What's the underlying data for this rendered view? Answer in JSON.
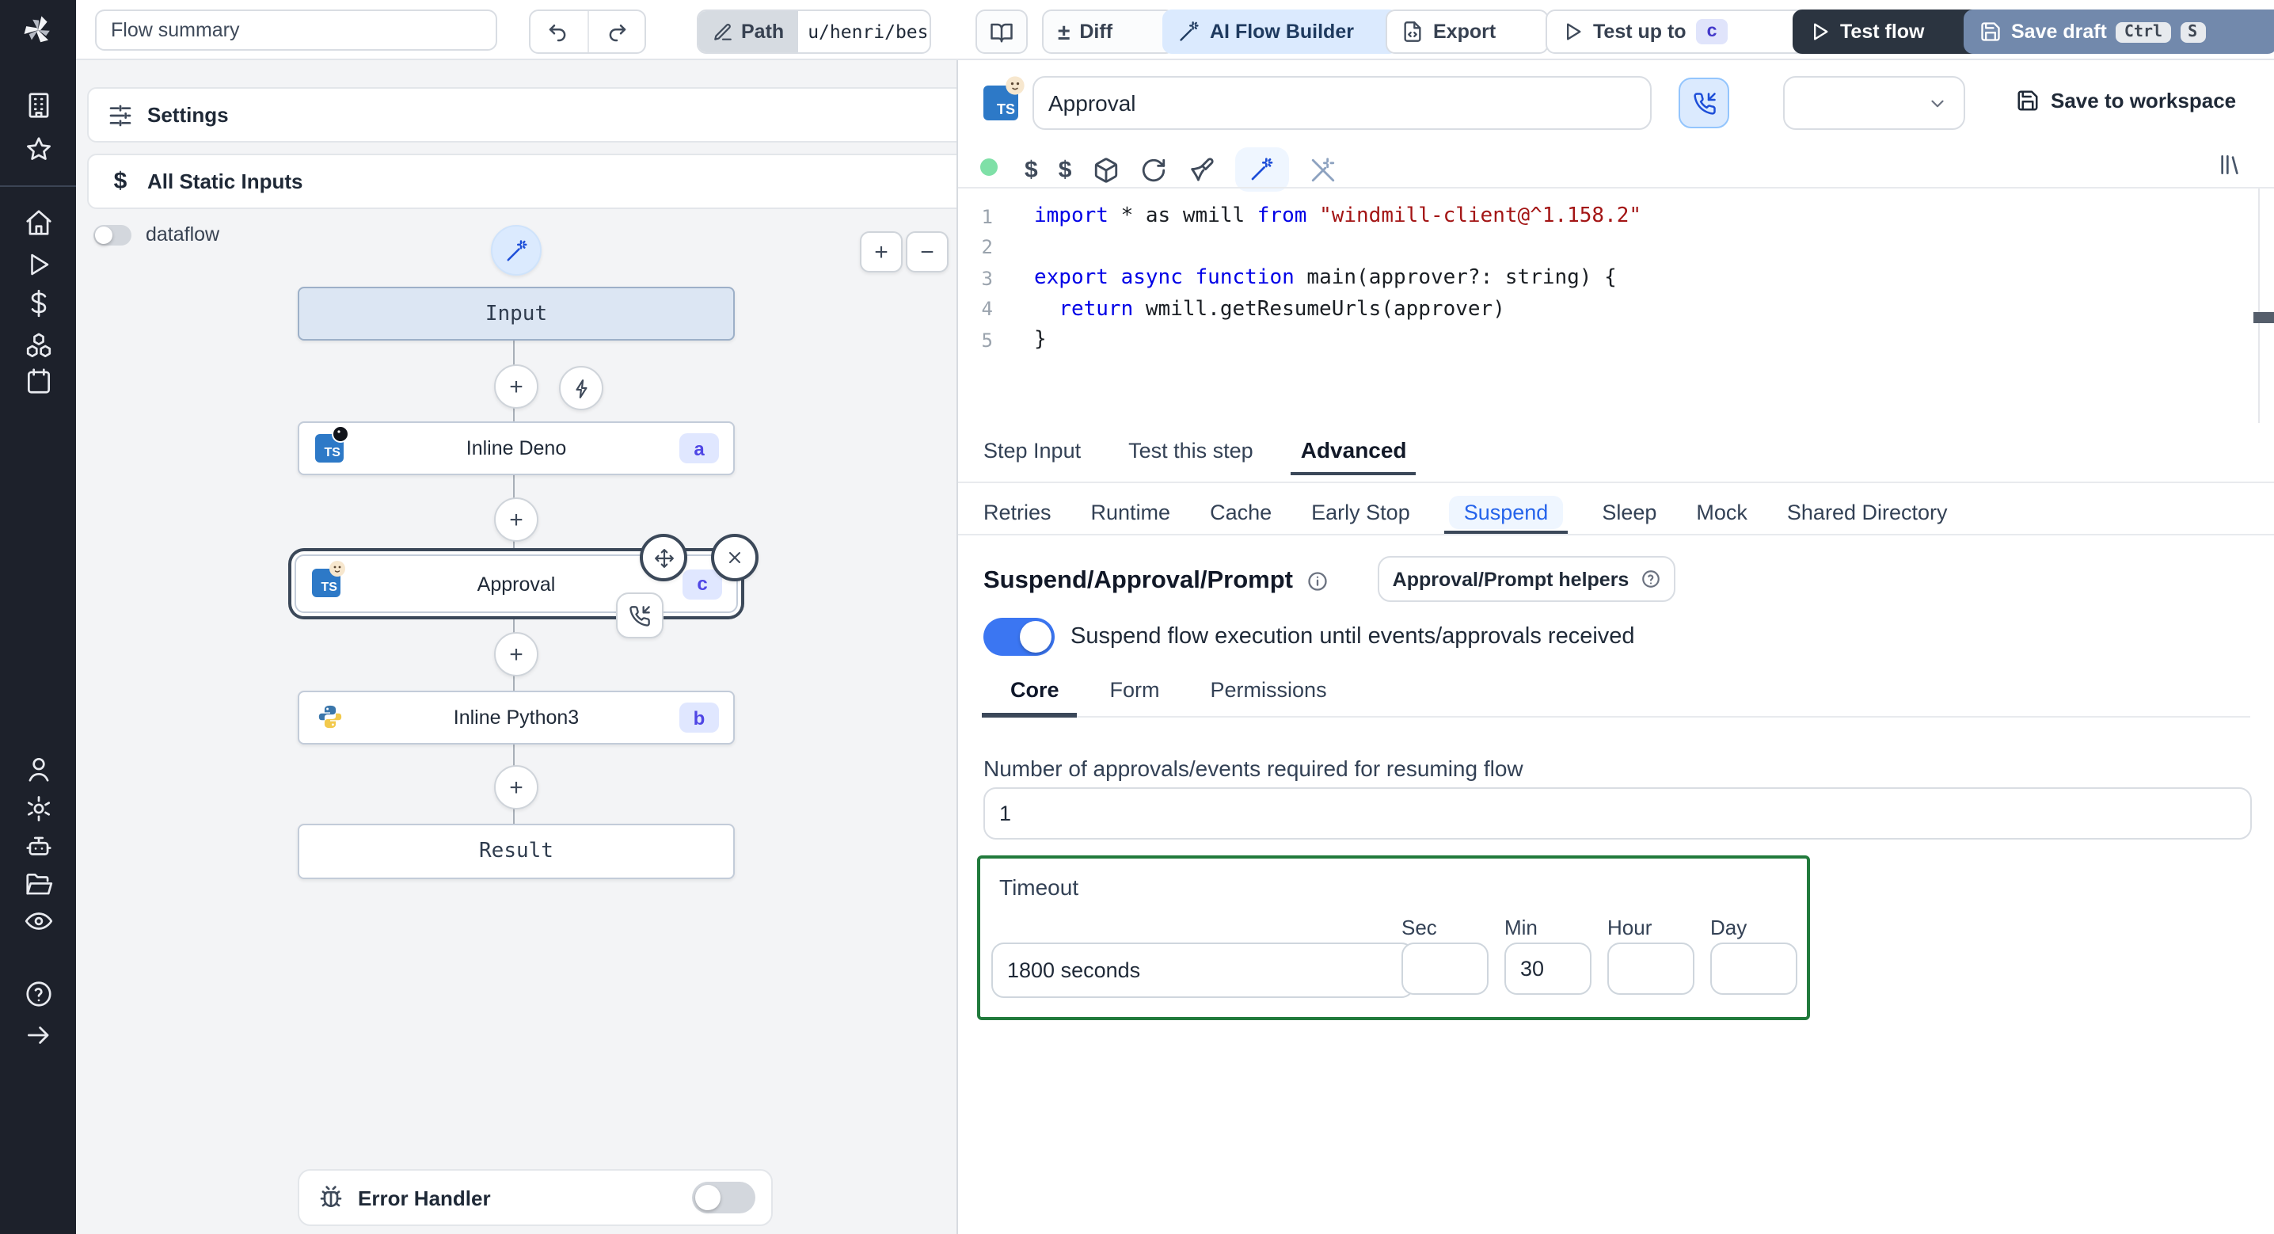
{
  "topbar": {
    "flow_summary": "Flow summary",
    "path_label": "Path",
    "path_value": "u/henri/bes",
    "diff_label": "Diff",
    "ai_flow_builder_label": "AI Flow Builder",
    "export_label": "Export",
    "test_up_to_label": "Test up to",
    "test_up_to_badge": "c",
    "test_flow_label": "Test flow",
    "save_draft_label": "Save draft",
    "save_draft_kbd": [
      "Ctrl",
      "S"
    ]
  },
  "rail_icons": [
    "windmill-logo",
    "building",
    "star",
    "home",
    "play",
    "dollar",
    "cubes",
    "calendar",
    "user",
    "settings",
    "robot",
    "folder-open",
    "eye",
    "help",
    "expand-arrow"
  ],
  "flow_panel": {
    "settings_label": "Settings",
    "static_inputs_label": "All Static Inputs",
    "dataflow_label": "dataflow",
    "input_node_label": "Input",
    "result_node_label": "Result",
    "steps": [
      {
        "id": "a",
        "label": "Inline Deno",
        "lang": "typescript-deno"
      },
      {
        "id": "c",
        "label": "Approval",
        "lang": "typescript-deno",
        "selected": true
      },
      {
        "id": "b",
        "label": "Inline Python3",
        "lang": "python3"
      }
    ],
    "error_handler_label": "Error Handler",
    "error_handler_enabled": false
  },
  "editor": {
    "step_name": "Approval",
    "save_to_workspace_label": "Save to workspace",
    "status_dot_color": "#7fe0a7",
    "code": {
      "language": "typescript",
      "lines": [
        [
          {
            "t": "kw",
            "v": "import"
          },
          {
            "t": "pl",
            "v": " * as wmill "
          },
          {
            "t": "kw",
            "v": "from"
          },
          {
            "t": "pl",
            "v": " "
          },
          {
            "t": "str",
            "v": "\"windmill-client@^1.158.2\""
          }
        ],
        [],
        [
          {
            "t": "kw",
            "v": "export"
          },
          {
            "t": "pl",
            "v": " "
          },
          {
            "t": "kw",
            "v": "async"
          },
          {
            "t": "pl",
            "v": " "
          },
          {
            "t": "kw",
            "v": "function"
          },
          {
            "t": "pl",
            "v": " main(approver?: string) {"
          }
        ],
        [
          {
            "t": "pl",
            "v": "  "
          },
          {
            "t": "kw",
            "v": "return"
          },
          {
            "t": "pl",
            "v": " wmill.getResumeUrls(approver)"
          }
        ],
        [
          {
            "t": "pl",
            "v": "}"
          }
        ]
      ]
    }
  },
  "tabs": {
    "items": [
      "Step Input",
      "Test this step",
      "Advanced"
    ],
    "active": "Advanced"
  },
  "subtabs": {
    "items": [
      "Retries",
      "Runtime",
      "Cache",
      "Early Stop",
      "Suspend",
      "Sleep",
      "Mock",
      "Shared Directory"
    ],
    "active": "Suspend"
  },
  "suspend": {
    "title": "Suspend/Approval/Prompt",
    "helpers_button_label": "Approval/Prompt helpers",
    "toggle_label": "Suspend flow execution until events/approvals received",
    "toggle_on": true,
    "inner_tabs": {
      "items": [
        "Core",
        "Form",
        "Permissions"
      ],
      "active": "Core"
    },
    "approvals_label": "Number of approvals/events required for resuming flow",
    "approvals_value": "1",
    "timeout": {
      "label": "Timeout",
      "display_value": "1800 seconds",
      "fields": [
        {
          "label": "Sec",
          "value": ""
        },
        {
          "label": "Min",
          "value": "30"
        },
        {
          "label": "Hour",
          "value": ""
        },
        {
          "label": "Day",
          "value": ""
        }
      ]
    }
  },
  "colors": {
    "accent_blue": "#3b76f2",
    "badge_bg": "#e0e7ff",
    "badge_text": "#4f46e5",
    "keyword": "#0000e6",
    "string": "#a31515",
    "timeout_border": "#217a3c",
    "status_dot": "#7fe0a7",
    "save_draft_bg": "#7289ac",
    "test_flow_bg": "#2b3440",
    "ai_builder_bg": "#dbeafe",
    "rail_bg": "#1d212b"
  }
}
